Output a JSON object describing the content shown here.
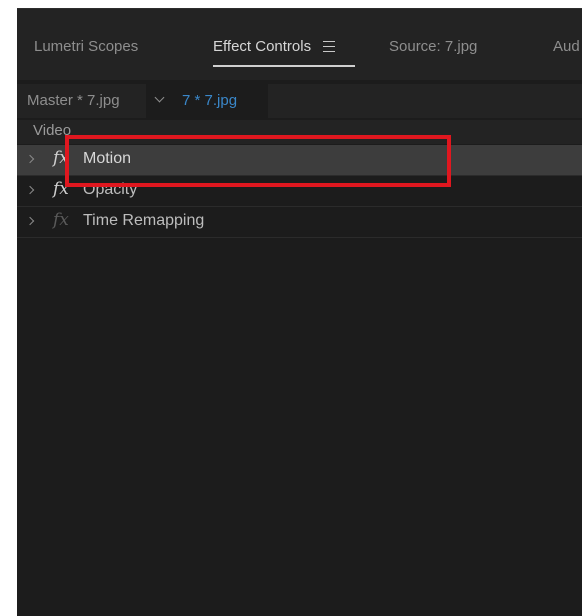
{
  "tabs": [
    {
      "label": "Lumetri Scopes",
      "active": false
    },
    {
      "label": "Effect Controls",
      "active": true
    },
    {
      "label": "Source: 7.jpg",
      "active": false
    },
    {
      "label": "Aud",
      "active": false
    }
  ],
  "source_bar": {
    "master_label": "Master * 7.jpg",
    "clip_label": "7 * 7.jpg"
  },
  "section": {
    "label": "Video"
  },
  "effects": [
    {
      "label": "Motion",
      "selected": true,
      "icon": "fx-icon"
    },
    {
      "label": "Opacity",
      "selected": false,
      "icon": "fx-icon"
    },
    {
      "label": "Time Remapping",
      "selected": false,
      "icon": "fx-icon-disabled"
    }
  ],
  "icons": {
    "fx": "fx",
    "tab_menu": "hamburger-menu-icon",
    "dropdown": "chevron-down-icon",
    "twirl": "chevron-right-icon"
  },
  "colors": {
    "panel_bg": "#1c1c1c",
    "header_bg": "#232323",
    "selected_row": "#3d3d3d",
    "clip_link": "#3a87c9",
    "highlight": "#e0171f"
  }
}
